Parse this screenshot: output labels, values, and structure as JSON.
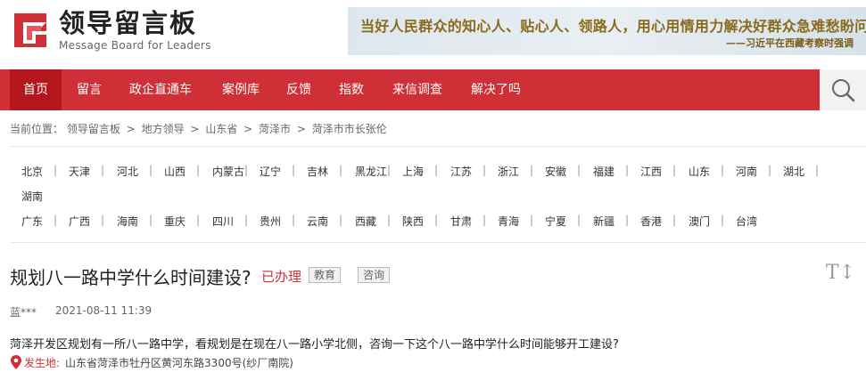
{
  "site": {
    "title": "领导留言板",
    "subtitle": "Message Board for Leaders",
    "brand_color": "#cf2f36"
  },
  "banner": {
    "quote": "当好人民群众的知心人、贴心人、领路人，用心用情用力解决好群众急难愁盼问题。",
    "attribution": "——习近平在西藏考察时强调"
  },
  "nav": {
    "items": [
      "首页",
      "留言",
      "政企直通车",
      "案例库",
      "反馈",
      "指数",
      "来信调查",
      "解决了吗"
    ],
    "search_icon": "search-icon"
  },
  "breadcrumb": {
    "label": "当前位置：",
    "items": [
      "领导留言板",
      "地方领导",
      "山东省",
      "菏泽市",
      "菏泽市市长张伦"
    ],
    "sep": ">"
  },
  "regions": {
    "row1": [
      "北京",
      "天津",
      "河北",
      "山西",
      "内蒙古",
      "辽宁",
      "吉林",
      "黑龙江",
      "上海",
      "江苏",
      "浙江",
      "安徽",
      "福建",
      "江西",
      "山东",
      "河南",
      "湖北"
    ],
    "row2": [
      "湖南"
    ],
    "row3": [
      "广东",
      "广西",
      "海南",
      "重庆",
      "四川",
      "贵州",
      "云南",
      "西藏",
      "陕西",
      "甘肃",
      "青海",
      "宁夏",
      "新疆",
      "香港",
      "澳门",
      "台湾"
    ],
    "separator": "|"
  },
  "message": {
    "title": "规划八一路中学什么时间建设?",
    "status": "已办理",
    "tags": [
      "教育",
      "咨询"
    ],
    "font_size_icon": "T↕",
    "author": "蓝***",
    "time": "2021-08-11 11:39",
    "body": "菏泽开发区规划有一所八一路中学，看规划是在现在八一路小学北侧，咨询一下这个八一路中学什么时间能够开工建设?",
    "location_label": "发生地:",
    "location": "山东省菏泽市牡丹区黄河东路3300号(纱厂南院)"
  }
}
